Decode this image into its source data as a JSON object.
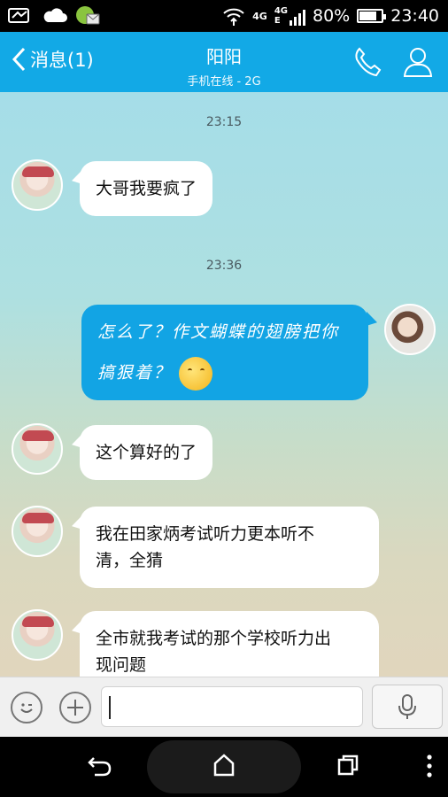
{
  "status_bar": {
    "network_left": "4G",
    "network_right": "4G",
    "network_sub": "E",
    "battery": "80%",
    "battery_level": 0.8,
    "time": "23:40",
    "icons": [
      "video-icon",
      "cloud-icon",
      "app-icon",
      "wifi-icon",
      "signal-icon",
      "battery-icon"
    ]
  },
  "header": {
    "back_label": "消息(1)",
    "title": "阳阳",
    "subtitle": "手机在线 - 2G",
    "accent_color": "#12a9e6"
  },
  "messages": [
    {
      "type": "time",
      "text": "23:15"
    },
    {
      "type": "received",
      "text": "大哥我要疯了"
    },
    {
      "type": "time",
      "text": "23:36"
    },
    {
      "type": "sent",
      "line1": "怎么了？作文蝴蝶的翅膀把你",
      "line2": "搞狠着？",
      "emoji": "thinking-face-emoji"
    },
    {
      "type": "received",
      "text": "这个算好的了"
    },
    {
      "type": "received",
      "line1": "我在田家炳考试听力更本听不",
      "line2": "清，全猜"
    },
    {
      "type": "received",
      "line1": "全市就我考试的那个学校听力出",
      "line2": "现问题"
    }
  ],
  "input": {
    "value": "",
    "placeholder": ""
  }
}
